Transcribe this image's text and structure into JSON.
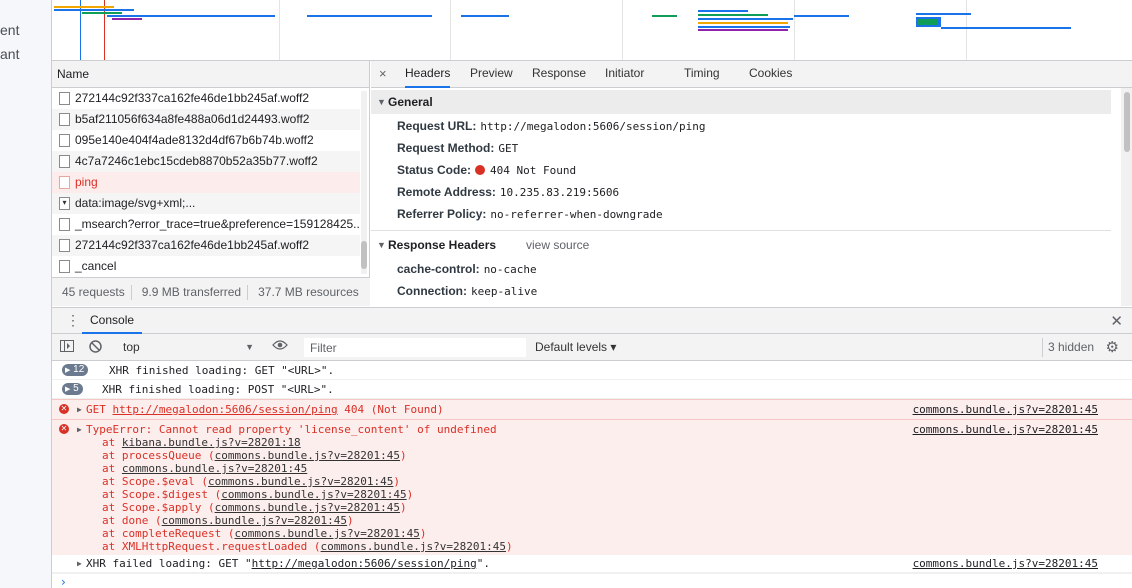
{
  "background_page": {
    "fragments": [
      "ent",
      "ant"
    ]
  },
  "network": {
    "name_header": "Name",
    "requests": [
      {
        "name": "272144c92f337ca162fe46de1bb245af.woff2",
        "type": "file",
        "status": "ok"
      },
      {
        "name": "b5af211056f634a8fe488a06d1d24493.woff2",
        "type": "file",
        "status": "ok"
      },
      {
        "name": "095e140e404f4ade8132d4df67b6b74b.woff2",
        "type": "file",
        "status": "ok"
      },
      {
        "name": "4c7a7246c1ebc15cdeb8870b52a35b77.woff2",
        "type": "file",
        "status": "ok"
      },
      {
        "name": "ping",
        "type": "file",
        "status": "error"
      },
      {
        "name": "data:image/svg+xml;...",
        "type": "svg",
        "status": "ok"
      },
      {
        "name": "_msearch?error_trace=true&preference=159128425...",
        "type": "file",
        "status": "ok"
      },
      {
        "name": "272144c92f337ca162fe46de1bb245af.woff2",
        "type": "file",
        "status": "ok"
      },
      {
        "name": "_cancel",
        "type": "file",
        "status": "ok"
      }
    ],
    "summary": {
      "requests": "45 requests",
      "transferred": "9.9 MB transferred",
      "resources": "37.7 MB resources"
    }
  },
  "detail": {
    "close_glyph": "×",
    "tabs": [
      "Headers",
      "Preview",
      "Response",
      "Initiator",
      "Timing",
      "Cookies"
    ],
    "active_tab": "Headers",
    "general": {
      "title": "General",
      "rows": [
        {
          "key": "Request URL:",
          "value": "http://megalodon:5606/session/ping"
        },
        {
          "key": "Request Method:",
          "value": "GET"
        },
        {
          "key": "Status Code:",
          "value": "404 Not Found",
          "status_color": "#d93025"
        },
        {
          "key": "Remote Address:",
          "value": "10.235.83.219:5606"
        },
        {
          "key": "Referrer Policy:",
          "value": "no-referrer-when-downgrade"
        }
      ]
    },
    "response_headers": {
      "title": "Response Headers",
      "view_source": "view source",
      "rows": [
        {
          "key": "cache-control:",
          "value": "no-cache"
        },
        {
          "key": "Connection:",
          "value": "keep-alive"
        }
      ]
    }
  },
  "console": {
    "tab_label": "Console",
    "context": "top",
    "filter_placeholder": "Filter",
    "levels": "Default levels ▾",
    "hidden": "3 hidden",
    "messages": [
      {
        "kind": "info",
        "count": "12",
        "text": "XHR finished loading: GET \"<URL>\"."
      },
      {
        "kind": "info",
        "count": "5",
        "text": "XHR finished loading: POST \"<URL>\"."
      },
      {
        "kind": "error",
        "prefix": "GET ",
        "link": "http://megalodon:5606/session/ping",
        "suffix": " 404 (Not Found)",
        "source": "commons.bundle.js?v=28201:45"
      },
      {
        "kind": "error",
        "text": "TypeError: Cannot read property 'license_content' of undefined",
        "source": "commons.bundle.js?v=28201:45"
      }
    ],
    "stack": [
      {
        "fn": "at ",
        "loc": "kibana.bundle.js?v=28201:18",
        "paren": false
      },
      {
        "fn": "at processQueue ",
        "loc": "commons.bundle.js?v=28201:45",
        "paren": true
      },
      {
        "fn": "at ",
        "loc": "commons.bundle.js?v=28201:45",
        "paren": false
      },
      {
        "fn": "at Scope.$eval ",
        "loc": "commons.bundle.js?v=28201:45",
        "paren": true
      },
      {
        "fn": "at Scope.$digest ",
        "loc": "commons.bundle.js?v=28201:45",
        "paren": true
      },
      {
        "fn": "at Scope.$apply ",
        "loc": "commons.bundle.js?v=28201:45",
        "paren": true
      },
      {
        "fn": "at done ",
        "loc": "commons.bundle.js?v=28201:45",
        "paren": true
      },
      {
        "fn": "at completeRequest ",
        "loc": "commons.bundle.js?v=28201:45",
        "paren": true
      },
      {
        "fn": "at XMLHttpRequest.requestLoaded ",
        "loc": "commons.bundle.js?v=28201:45",
        "paren": true
      }
    ],
    "last_message": {
      "prefix": "XHR failed loading: GET \"",
      "link": "http://megalodon:5606/session/ping",
      "suffix": "\".",
      "source": "commons.bundle.js?v=28201:45"
    },
    "prompt_glyph": "›"
  },
  "colors": {
    "accent": "#1a73e8",
    "error": "#d93025",
    "error_bg": "#fdeeee"
  }
}
